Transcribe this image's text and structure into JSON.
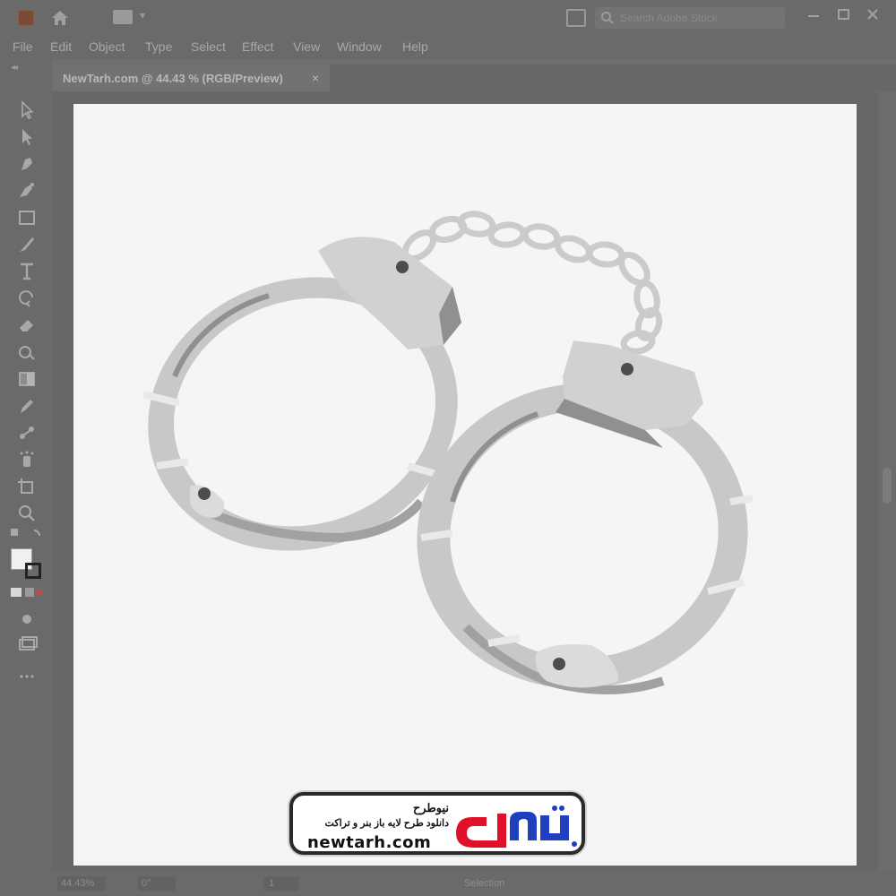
{
  "appbar": {
    "search_placeholder": "Search Adobe Stock"
  },
  "menu": {
    "items": [
      "File",
      "Edit",
      "Object",
      "Type",
      "Select",
      "Effect",
      "View",
      "Window",
      "Help"
    ]
  },
  "document": {
    "tab_label": "NewTarh.com @ 44.43 % (RGB/Preview)",
    "close_glyph": "×"
  },
  "status": {
    "zoom": "44.43%",
    "rotation": "0°",
    "artboard_number": "1",
    "tool_name": "Selection"
  },
  "watermark": {
    "brand_fa": "نیوطرح",
    "tagline_fa": "دانلود طرح لایه باز بنر و تراکت",
    "url": "newtarh.com",
    "logo_fa": "نیوطرح"
  },
  "colors": {
    "chrome_bg": "#6a6a6a",
    "artboard_bg": "#f4f5f6",
    "metal_light": "#c8cacc",
    "metal_dark": "#8e9092",
    "logo_red": "#e0102a",
    "logo_blue": "#1f3fbf"
  },
  "icons": {
    "tools": [
      "selection-tool-icon",
      "direct-selection-tool-icon",
      "pen-tool-icon",
      "curvature-tool-icon",
      "rectangle-tool-icon",
      "paintbrush-tool-icon",
      "type-tool-icon",
      "rotate-tool-icon",
      "eraser-tool-icon",
      "shape-builder-tool-icon",
      "gradient-tool-icon",
      "eyedropper-tool-icon",
      "blend-tool-icon",
      "symbol-sprayer-tool-icon",
      "artboard-tool-icon",
      "zoom-tool-icon"
    ]
  }
}
